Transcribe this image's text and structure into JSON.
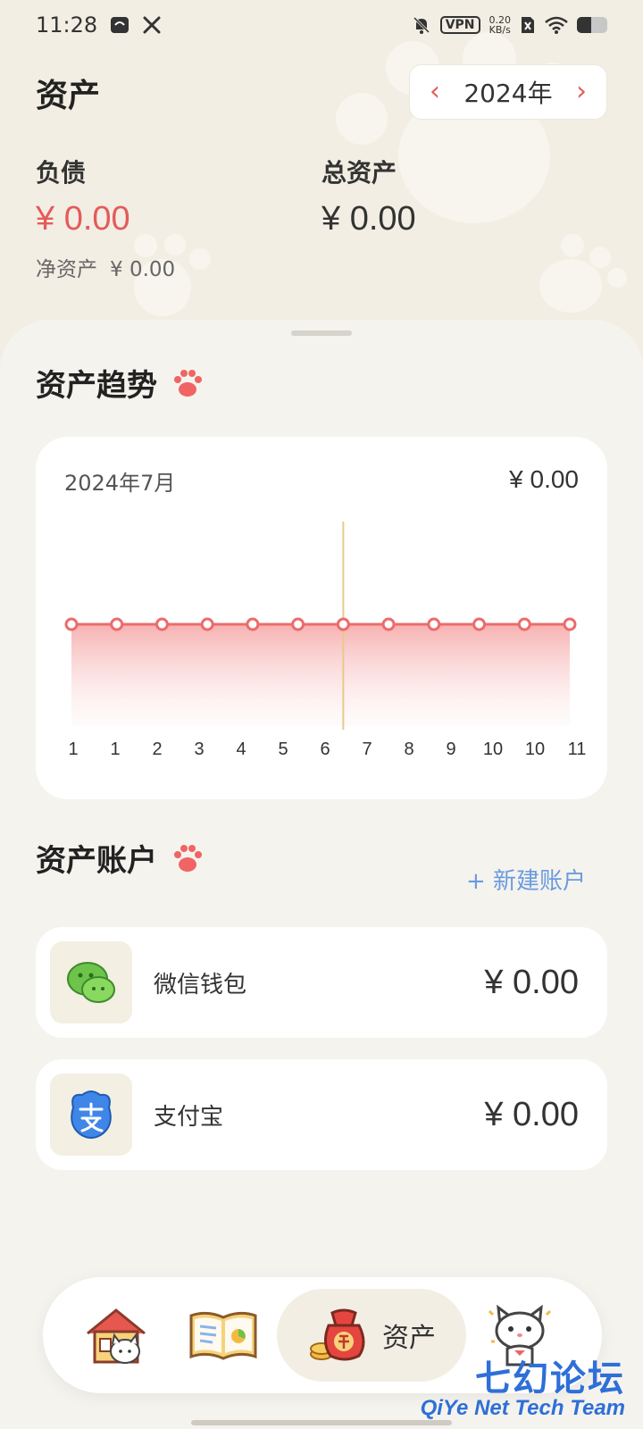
{
  "status_bar": {
    "time": "11:28",
    "vpn": "VPN",
    "speed_value": "0.20",
    "speed_unit": "KB/s"
  },
  "header": {
    "title": "资产",
    "year": "2024年",
    "prev_icon": "chevron-left-icon",
    "next_icon": "chevron-right-icon"
  },
  "summary": {
    "liabilities_label": "负债",
    "liabilities_value": "¥ 0.00",
    "total_assets_label": "总资产",
    "total_assets_value": "¥ 0.00",
    "net_assets_label": "净资产",
    "net_assets_value": "¥ 0.00"
  },
  "trend": {
    "title": "资产趋势",
    "month": "2024年7月",
    "total": "¥ 0.00"
  },
  "chart_data": {
    "type": "area",
    "categories": [
      "1",
      "1",
      "2",
      "3",
      "4",
      "5",
      "6",
      "7",
      "8",
      "9",
      "10",
      "10",
      "11"
    ],
    "values": [
      0,
      0,
      0,
      0,
      0,
      0,
      0,
      0,
      0,
      0,
      0,
      0
    ],
    "selected_index": 6
  },
  "accounts": {
    "title": "资产账户",
    "add_label": "+ 新建账户",
    "items": [
      {
        "name": "微信钱包",
        "amount": "¥ 0.00",
        "icon": "wechat-icon"
      },
      {
        "name": "支付宝",
        "amount": "¥ 0.00",
        "icon": "alipay-icon"
      }
    ]
  },
  "tabbar": {
    "tabs": [
      {
        "name": "home",
        "icon": "house-cat-icon"
      },
      {
        "name": "ledger",
        "icon": "open-book-icon"
      },
      {
        "name": "assets",
        "icon": "money-bag-icon",
        "label": "资产",
        "active": true
      },
      {
        "name": "profile",
        "icon": "cat-icon"
      }
    ]
  },
  "watermark": {
    "cn": "七幻论坛",
    "en": "QiYe Net Tech Team"
  },
  "colors": {
    "accent_red": "#e45b5b",
    "link_blue": "#6a9be0",
    "background": "#f5f2ea"
  }
}
